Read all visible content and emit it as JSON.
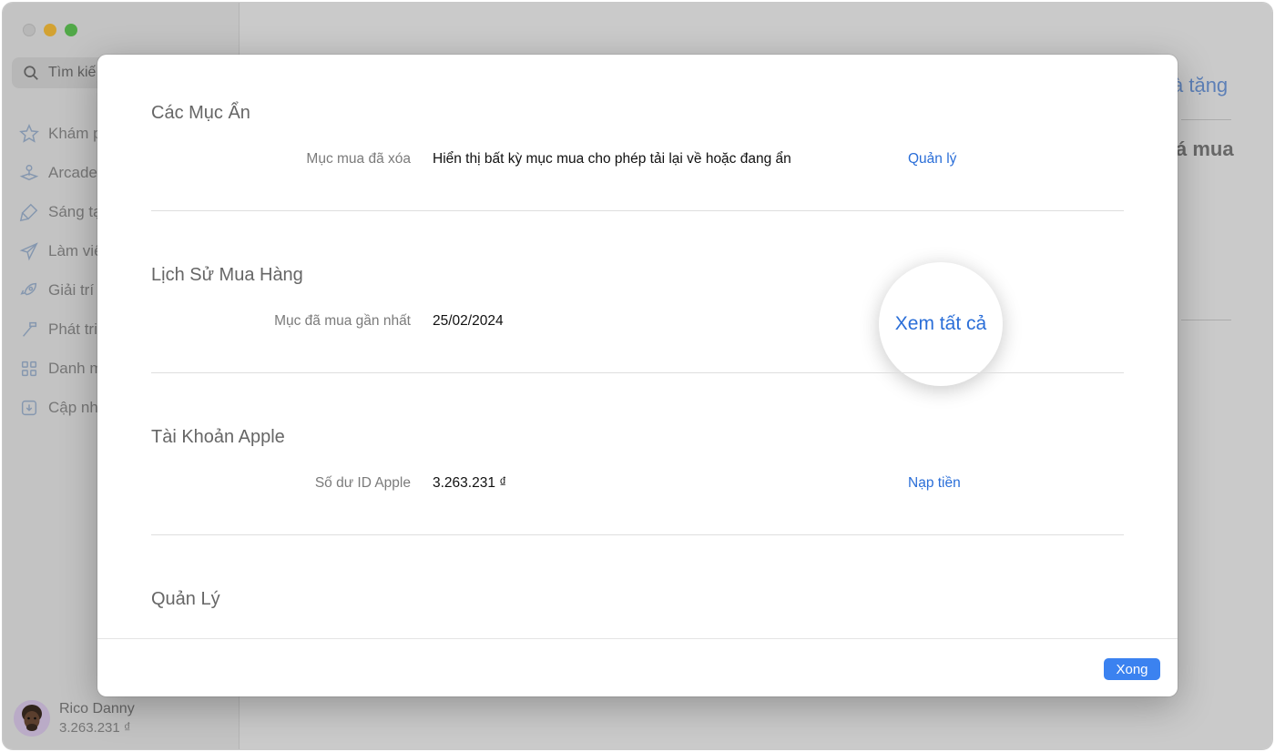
{
  "sidebar": {
    "search_placeholder": "Tìm kiế",
    "items": [
      {
        "label": "Khám p",
        "icon": "star-icon"
      },
      {
        "label": "Arcade",
        "icon": "joystick-icon"
      },
      {
        "label": "Sáng tạ",
        "icon": "brush-icon"
      },
      {
        "label": "Làm việ",
        "icon": "paper-plane-icon"
      },
      {
        "label": "Giải trí",
        "icon": "rocket-icon"
      },
      {
        "label": "Phát triể",
        "icon": "hammer-icon"
      },
      {
        "label": "Danh m",
        "icon": "grid-icon"
      },
      {
        "label": "Cập nh",
        "icon": "download-icon"
      }
    ],
    "account": {
      "name": "Rico Danny",
      "balance": "3.263.231 ₫"
    }
  },
  "background": {
    "link_partial": "à tặng",
    "heading_partial": "á mua"
  },
  "sheet": {
    "sections": [
      {
        "title": "Các Mục Ẩn",
        "label": "Mục mua đã xóa",
        "value": "Hiển thị bất kỳ mục mua cho phép tải lại về hoặc đang ẩn",
        "link": "Quản lý"
      },
      {
        "title": "Lịch Sử Mua Hàng",
        "label": "Mục đã mua gần nhất",
        "value": "25/02/2024",
        "link": "Xem tất cả"
      },
      {
        "title": "Tài Khoản Apple",
        "label": "Số dư ID Apple",
        "value": "3.263.231 ₫",
        "link": "Nạp tiền"
      },
      {
        "title": "Quản Lý"
      }
    ],
    "done_label": "Xong"
  },
  "colors": {
    "accent": "#2a6ed8",
    "button": "#3b82f0"
  }
}
